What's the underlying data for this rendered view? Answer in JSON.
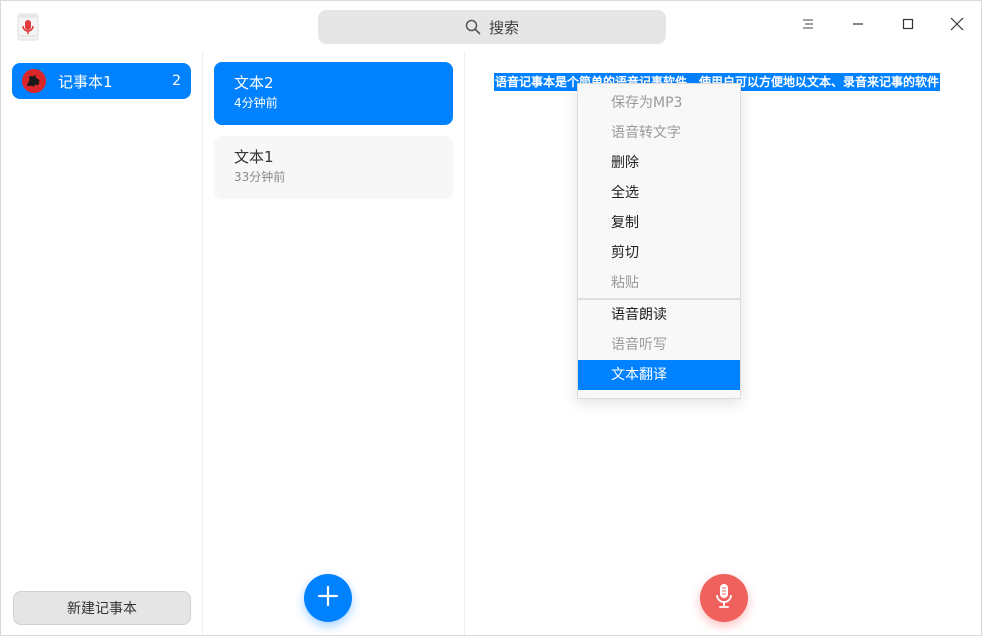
{
  "app": {
    "title_icon": "voice-notepad-icon",
    "search": {
      "placeholder": "搜索",
      "icon": "search-icon"
    },
    "window_controls": [
      "menu-icon",
      "minimize-icon",
      "maximize-icon",
      "close-icon"
    ]
  },
  "sidebar": {
    "notebooks": [
      {
        "name": "记事本1",
        "count": "2",
        "selected": true
      }
    ],
    "new_notebook_label": "新建记事本"
  },
  "notes": {
    "items": [
      {
        "title": "文本2",
        "time": "4分钟前",
        "selected": true
      },
      {
        "title": "文本1",
        "time": "33分钟前",
        "selected": false
      }
    ],
    "add_button_icon": "plus-icon"
  },
  "editor": {
    "content": "语音记事本是个简单的语音记事软件，使用户可以方便地以文本、录音来记事的软件",
    "selected": true,
    "record_button_icon": "microphone-icon"
  },
  "context_menu": {
    "items": [
      {
        "label": "保存为MP3",
        "disabled": true
      },
      {
        "label": "语音转文字",
        "disabled": true
      },
      {
        "label": "删除",
        "disabled": false
      },
      {
        "label": "全选",
        "disabled": false
      },
      {
        "label": "复制",
        "disabled": false
      },
      {
        "label": "剪切",
        "disabled": false
      },
      {
        "label": "粘贴",
        "disabled": true
      },
      {
        "label": "语音朗读",
        "disabled": false
      },
      {
        "label": "语音听写",
        "disabled": true
      },
      {
        "label": "文本翻译",
        "disabled": false,
        "highlighted": true
      }
    ]
  },
  "colors": {
    "accent": "#0081ff",
    "record": "#f0605d",
    "disabled_text": "#9a9a9a"
  }
}
